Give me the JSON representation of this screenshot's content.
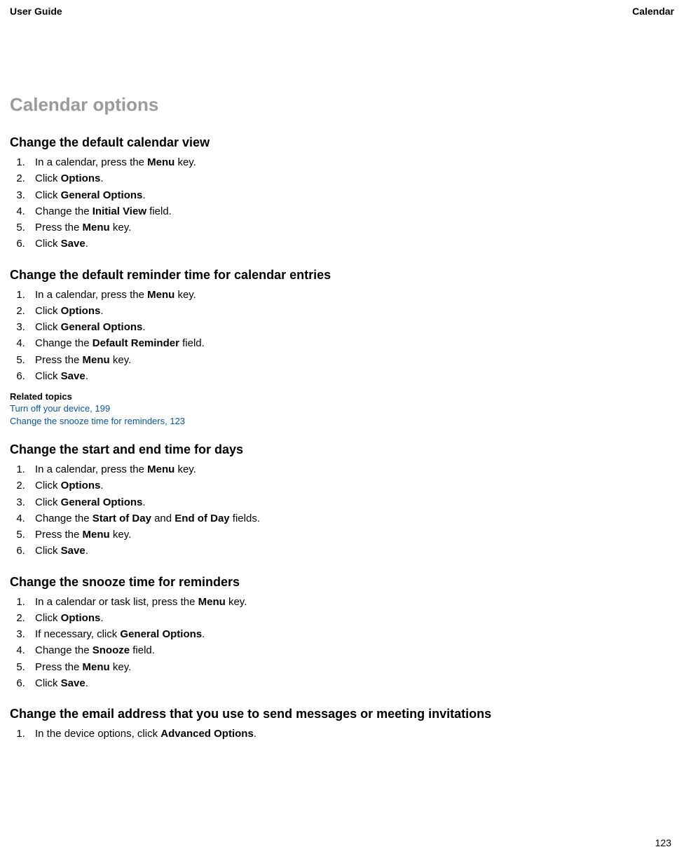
{
  "header": {
    "left": "User Guide",
    "right": "Calendar"
  },
  "pageTitle": "Calendar options",
  "pageNumber": "123",
  "sections": [
    {
      "heading": "Change the default calendar view",
      "steps": [
        "In a calendar, press the <b>Menu</b> key.",
        "Click <b>Options</b>.",
        "Click <b>General Options</b>.",
        "Change the <b>Initial View</b> field.",
        "Press the <b>Menu</b> key.",
        "Click <b>Save</b>."
      ]
    },
    {
      "heading": "Change the default reminder time for calendar entries",
      "steps": [
        "In a calendar, press the <b>Menu</b> key.",
        "Click <b>Options</b>.",
        "Click <b>General Options</b>.",
        "Change the <b>Default Reminder</b> field.",
        "Press the <b>Menu</b> key.",
        "Click <b>Save</b>."
      ],
      "related": {
        "heading": "Related topics",
        "links": [
          "Turn off your device, 199",
          "Change the snooze time for reminders, 123"
        ]
      }
    },
    {
      "heading": "Change the start and end time for days",
      "steps": [
        "In a calendar, press the <b>Menu</b> key.",
        "Click <b>Options</b>.",
        "Click <b>General Options</b>.",
        "Change the <b>Start of Day</b> and <b>End of Day</b> fields.",
        "Press the <b>Menu</b> key.",
        "Click <b>Save</b>."
      ]
    },
    {
      "heading": "Change the snooze time for reminders",
      "steps": [
        "In a calendar or task list, press the <b>Menu</b> key.",
        "Click <b>Options</b>.",
        "If necessary, click <b>General Options</b>.",
        "Change the <b>Snooze</b> field.",
        "Press the <b>Menu</b> key.",
        "Click <b>Save</b>."
      ]
    },
    {
      "heading": "Change the email address that you use to send messages or meeting invitations",
      "steps": [
        "In the device options, click <b>Advanced Options</b>."
      ]
    }
  ]
}
